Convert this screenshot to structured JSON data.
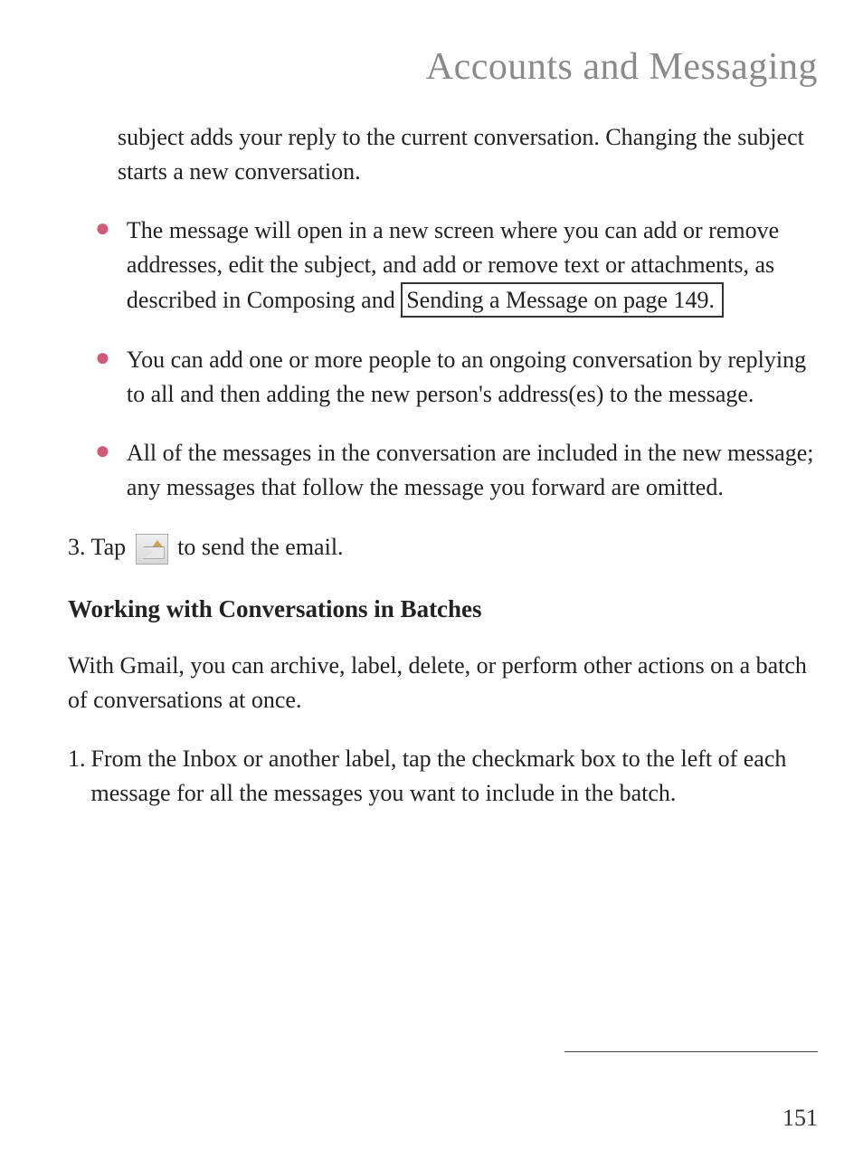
{
  "header": {
    "title": "Accounts and Messaging"
  },
  "content": {
    "intro_fragment": "subject adds your reply to the current conversation. Changing the subject starts a new conversation.",
    "bullets": [
      {
        "text_before_link": "The message will open in a new screen where you can add or remove addresses, edit the subject, and add or remove text or attachments, as described in Composing and ",
        "link_text": "Sending a Message on page 149."
      },
      {
        "text": "You can add one or more people to an ongoing conversation by replying to all and then adding the new person's address(es) to the message."
      },
      {
        "text": "All of the messages in the conversation are included in the new message; any messages that follow the message you forward are omitted."
      }
    ],
    "step3": {
      "prefix": "3. Tap ",
      "suffix": " to send the email.",
      "icon_name": "send-email-icon"
    },
    "section_heading": "Working with Conversations in Batches",
    "section_para": "With Gmail, you can archive, label, delete, or perform other actions on a batch of conversations at once.",
    "step1": {
      "num": "1.",
      "text": "From the Inbox or another label, tap the checkmark box to the left of each message for all the messages you want to include in the batch."
    }
  },
  "footer": {
    "page_number": "151"
  }
}
